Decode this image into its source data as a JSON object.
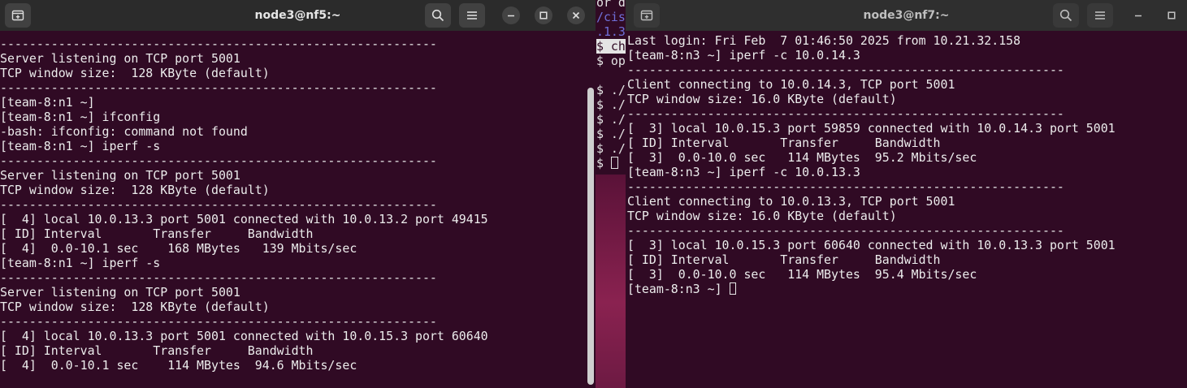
{
  "left_window": {
    "title": "node3@nf5:~",
    "new_tab_icon": "new-tab-icon",
    "search_icon": "search-icon",
    "menu_icon": "hamburger-menu-icon",
    "minimize_icon": "minimize-icon",
    "maximize_icon": "maximize-icon",
    "close_icon": "close-icon",
    "terminal_text": "------------------------------------------------------------\nServer listening on TCP port 5001\nTCP window size:  128 KByte (default)\n------------------------------------------------------------\n[team-8:n1 ~]\n[team-8:n1 ~] ifconfig\n-bash: ifconfig: command not found\n[team-8:n1 ~] iperf -s\n------------------------------------------------------------\nServer listening on TCP port 5001\nTCP window size:  128 KByte (default)\n------------------------------------------------------------\n[  4] local 10.0.13.3 port 5001 connected with 10.0.13.2 port 49415\n[ ID] Interval       Transfer     Bandwidth\n[  4]  0.0-10.1 sec    168 MBytes   139 Mbits/sec\n[team-8:n1 ~] iperf -s\n------------------------------------------------------------\nServer listening on TCP port 5001\nTCP window size:  128 KByte (default)\n------------------------------------------------------------\n[  4] local 10.0.13.3 port 5001 connected with 10.0.15.3 port 60640\n[ ID] Interval       Transfer     Bandwidth\n[  4]  0.0-10.1 sec    114 MBytes  94.6 Mbits/sec"
  },
  "right_window": {
    "title": "node3@nf7:~",
    "new_tab_icon": "new-tab-icon",
    "search_icon": "search-icon",
    "menu_icon": "hamburger-menu-icon",
    "minimize_icon": "minimize-icon",
    "maximize_icon": "maximize-icon",
    "terminal_text": "Last login: Fri Feb  7 01:46:50 2025 from 10.21.32.158\n[team-8:n3 ~] iperf -c 10.0.14.3\n------------------------------------------------------------\nClient connecting to 10.0.14.3, TCP port 5001\nTCP window size: 16.0 KByte (default)\n------------------------------------------------------------\n[  3] local 10.0.15.3 port 59859 connected with 10.0.14.3 port 5001\n[ ID] Interval       Transfer     Bandwidth\n[  3]  0.0-10.0 sec   114 MBytes  95.2 Mbits/sec\n[team-8:n3 ~] iperf -c 10.0.13.3\n------------------------------------------------------------\nClient connecting to 10.0.13.3, TCP port 5001\nTCP window size: 16.0 KByte (default)\n------------------------------------------------------------\n[  3] local 10.0.15.3 port 60640 connected with 10.0.13.3 port 5001\n[ ID] Interval       Transfer     Bandwidth\n[  3]  0.0-10.0 sec   114 MBytes  95.4 Mbits/sec",
    "prompt": "[team-8:n3 ~] "
  },
  "background_terminal": {
    "lines": [
      "or d",
      "/cis",
      ".1.3",
      "$ ch",
      "$ op",
      "",
      "$ ./",
      "$ ./",
      "$ ./",
      "$ ./",
      "$ ./",
      "$ "
    ]
  }
}
